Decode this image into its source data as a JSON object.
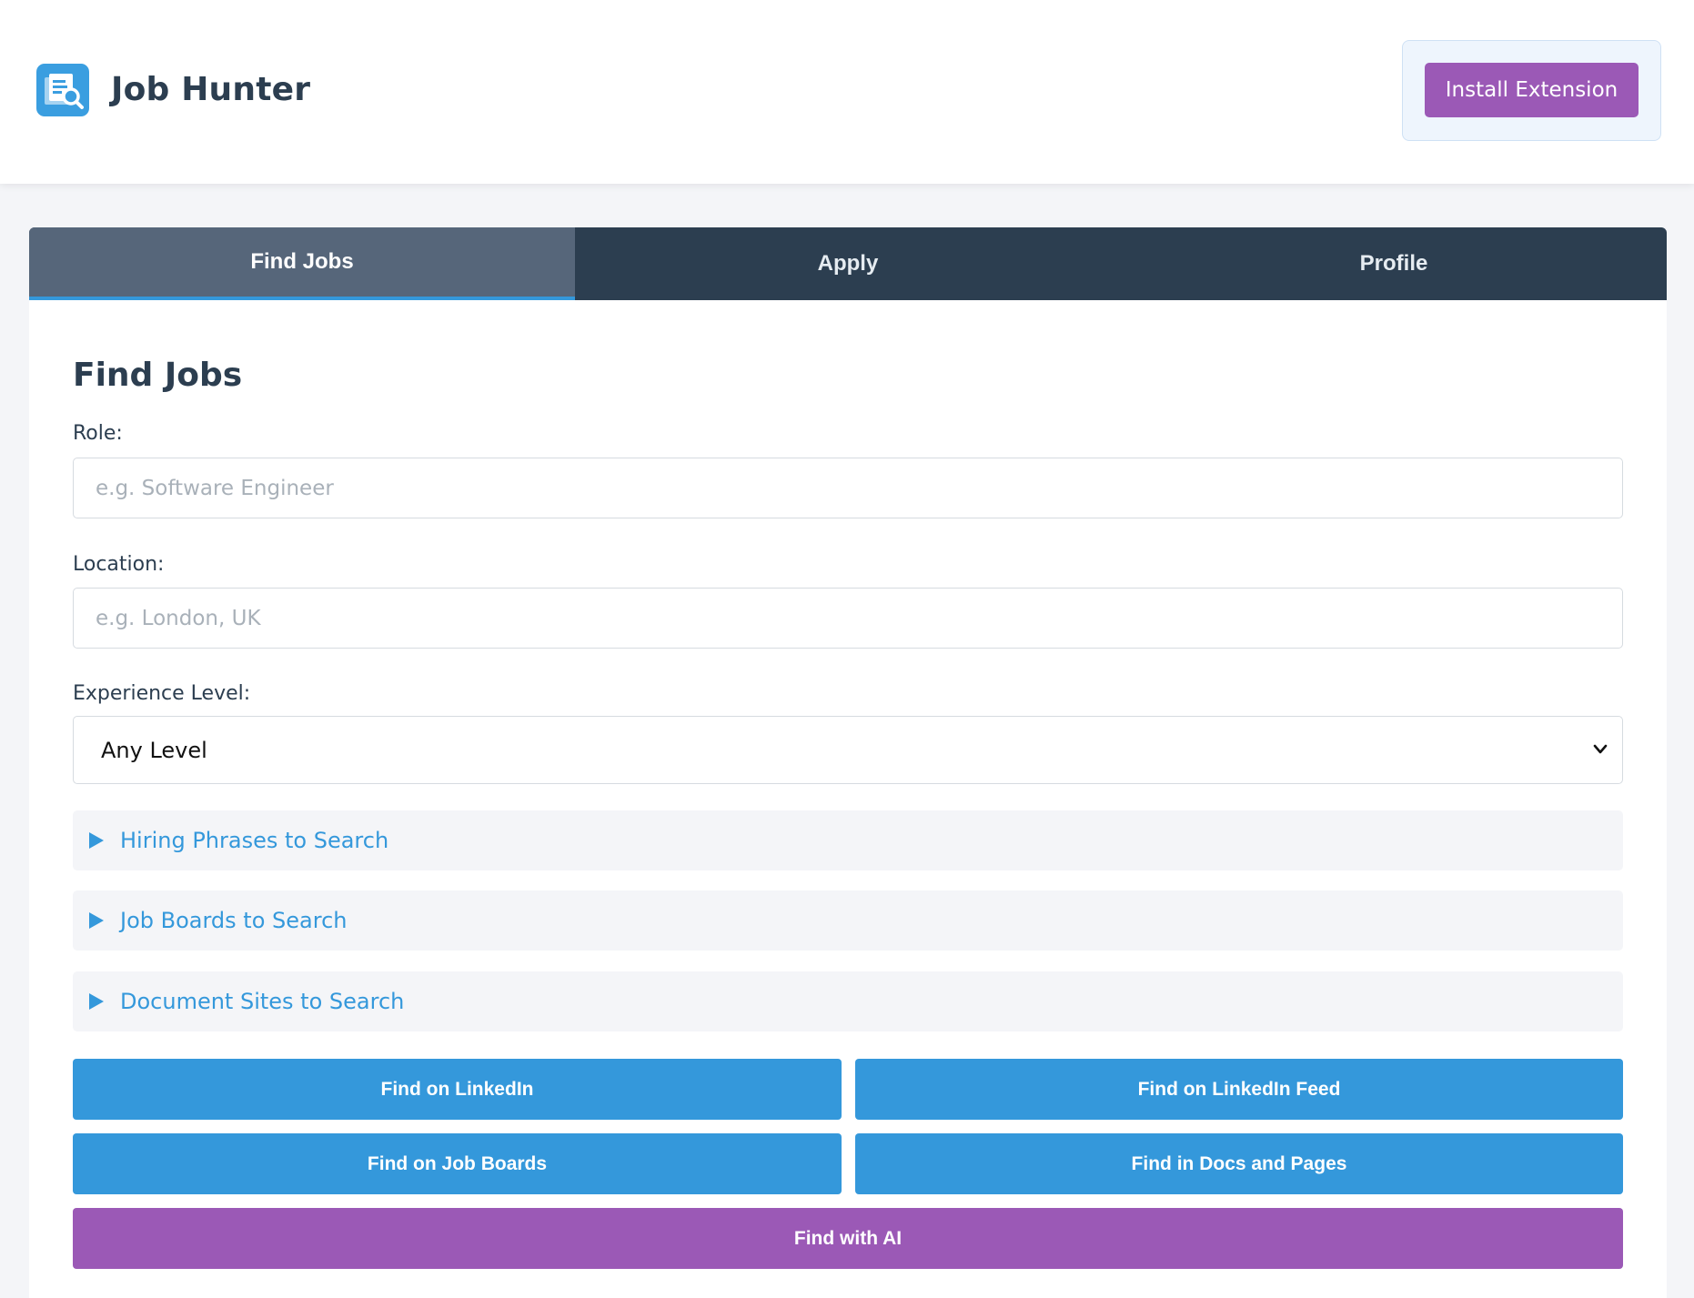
{
  "header": {
    "logo_icon": "document-search-icon",
    "title": "Job Hunter",
    "install_label": "Install Extension"
  },
  "tabs": [
    {
      "label": "Find Jobs",
      "active": true
    },
    {
      "label": "Apply",
      "active": false
    },
    {
      "label": "Profile",
      "active": false
    }
  ],
  "find_jobs": {
    "title": "Find Jobs",
    "role": {
      "label": "Role:",
      "placeholder": "e.g. Software Engineer",
      "value": ""
    },
    "location": {
      "label": "Location:",
      "placeholder": "e.g. London, UK",
      "value": ""
    },
    "experience": {
      "label": "Experience Level:",
      "selected": "Any Level"
    },
    "accordions": [
      {
        "label": "Hiring Phrases to Search",
        "icon": "triangle-right-icon"
      },
      {
        "label": "Job Boards to Search",
        "icon": "triangle-right-icon"
      },
      {
        "label": "Document Sites to Search",
        "icon": "triangle-right-icon"
      }
    ],
    "buttons": {
      "linkedin": "Find on LinkedIn",
      "linkedin_feed": "Find on LinkedIn Feed",
      "job_boards": "Find on Job Boards",
      "docs_pages": "Find in Docs and Pages",
      "ai": "Find with AI"
    }
  },
  "colors": {
    "primary": "#3498db",
    "accent": "#9b59b6",
    "nav": "#2c3e50",
    "nav_active": "#56667a"
  }
}
